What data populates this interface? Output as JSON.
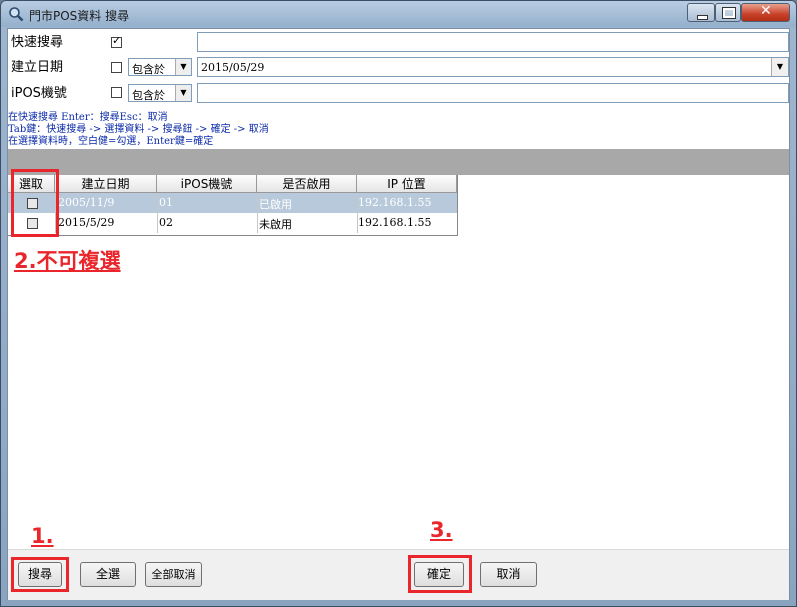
{
  "window": {
    "title": "門市POS資料 搜尋"
  },
  "filters": {
    "quick_search_label": "快速搜尋",
    "quick_search_checked": true,
    "create_date_label": "建立日期",
    "create_date_op": "包含於",
    "create_date_value": "2015/05/29",
    "ipos_label": "iPOS機號",
    "ipos_op": "包含於"
  },
  "hints": [
    "在快速搜尋 Enter：搜尋Esc：取消",
    "Tab鍵：快速搜尋 -> 選擇資料 -> 搜尋鈕 -> 確定 -> 取消",
    "在選擇資料時，空白健=勾選，Enter鍵=確定"
  ],
  "grid": {
    "headers": [
      "選取",
      "建立日期",
      "iPOS機號",
      "是否啟用",
      "IP 位置"
    ],
    "rows": [
      {
        "date": "2005/11/9",
        "pos": "01",
        "enabled": "已啟用",
        "ip": "192.168.1.55",
        "selected": true
      },
      {
        "date": "2015/5/29",
        "pos": "02",
        "enabled": "未啟用",
        "ip": "192.168.1.55",
        "selected": false
      }
    ]
  },
  "annotations": {
    "step1": "1.",
    "step2": "2.不可複選",
    "step3": "3."
  },
  "buttons": {
    "search": "搜尋",
    "select_all": "全選",
    "clear_all": "全部取消",
    "confirm": "確定",
    "cancel": "取消"
  }
}
